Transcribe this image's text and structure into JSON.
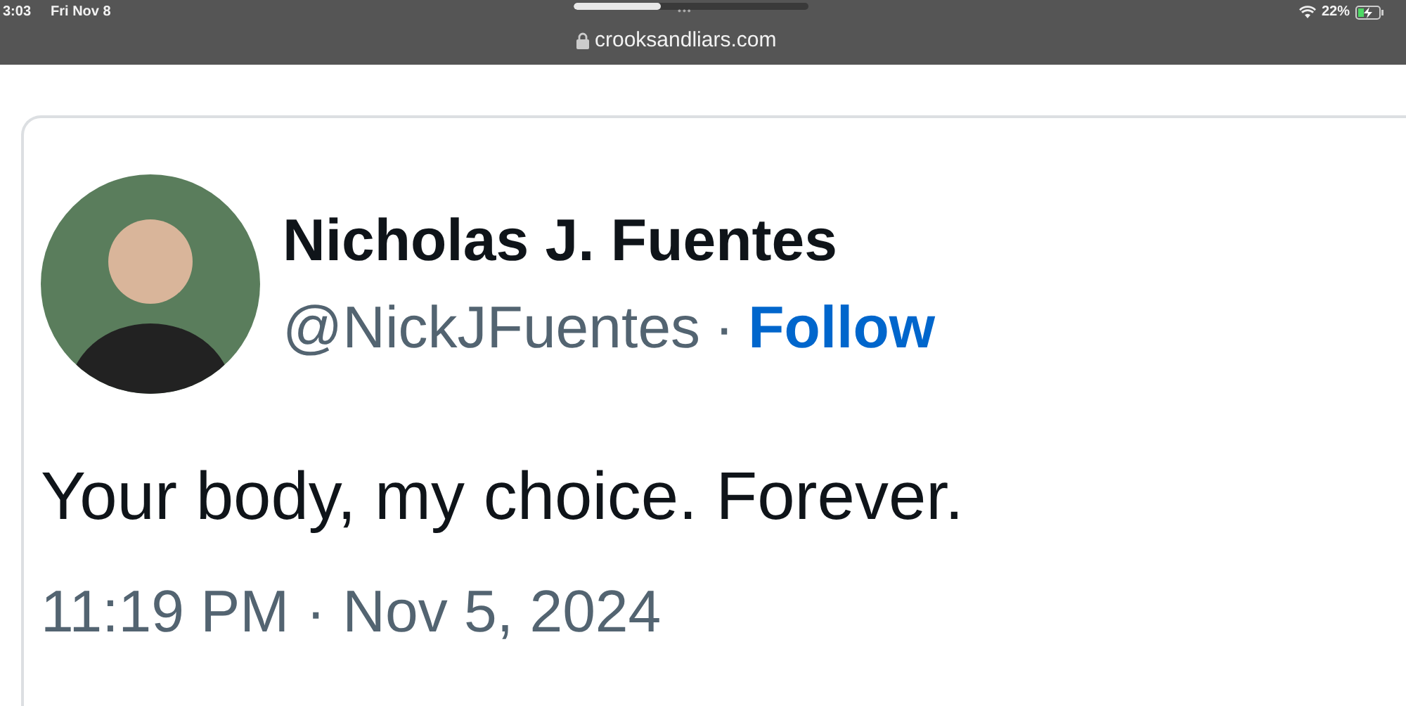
{
  "status_bar": {
    "time": "3:03",
    "date": "Fri Nov 8",
    "battery": "22%"
  },
  "browser": {
    "url": "crooksandliars.com",
    "load_progress": {
      "level": 0.37
    },
    "more": "•••"
  },
  "tweet": {
    "name": "Nicholas J. Fuentes",
    "handle": "@NickJFuentes",
    "separator": "·",
    "follow": "Follow",
    "text": "Your body, my choice. Forever.",
    "time": "11:19 PM",
    "separator2": "·",
    "date": "Nov 5, 2024"
  }
}
